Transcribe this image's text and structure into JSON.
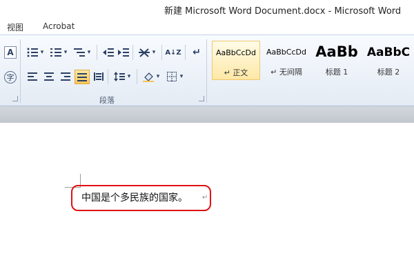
{
  "window": {
    "title": "新建 Microsoft Word Document.docx  -  Microsoft Word"
  },
  "menu": {
    "tabs": [
      "视图",
      "Acrobat"
    ]
  },
  "ribbon": {
    "paragraph_group_label": "段落",
    "styles": [
      {
        "sample": "AaBbCcDd",
        "name": "↵ 正文",
        "selected": true
      },
      {
        "sample": "AaBbCcDd",
        "name": "↵ 无间隔",
        "selected": false
      },
      {
        "sample": "AaBb",
        "name": "标题 1",
        "selected": false
      },
      {
        "sample": "AaBbC",
        "name": "标题 2",
        "selected": false
      }
    ],
    "icons": {
      "text_effect": "A",
      "phonetic": "字",
      "sort": "A↓Z",
      "dropdown": "▾"
    }
  },
  "document": {
    "text": "中国是个多民族的国家。",
    "paragraph_mark": "↵"
  },
  "colors": {
    "highlight_border": "#e01010",
    "selected_style": "#fde8a6"
  }
}
